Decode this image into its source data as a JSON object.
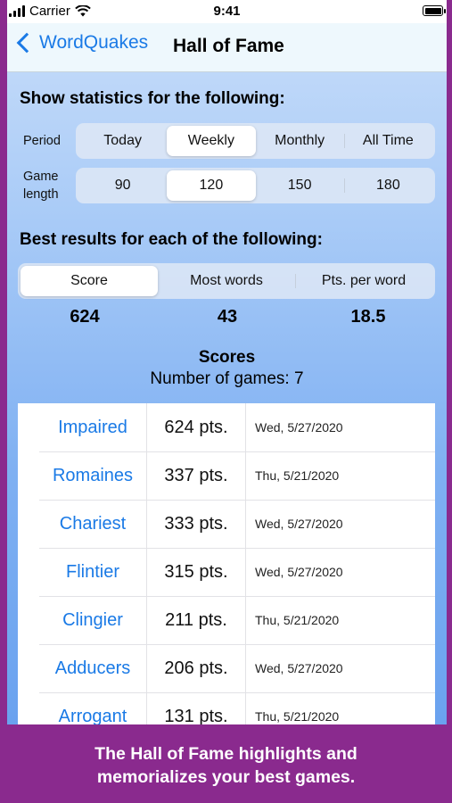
{
  "status_bar": {
    "carrier": "Carrier",
    "time": "9:41"
  },
  "nav": {
    "back_label": "WordQuakes",
    "title": "Hall of Fame"
  },
  "filters": {
    "heading": "Show statistics for the following:",
    "period": {
      "label": "Period",
      "options": [
        "Today",
        "Weekly",
        "Monthly",
        "All Time"
      ],
      "selected": "Weekly"
    },
    "game_length": {
      "label_line1": "Game",
      "label_line2": "length",
      "options": [
        "90",
        "120",
        "150",
        "180"
      ],
      "selected": "120"
    }
  },
  "best": {
    "heading": "Best results for each of the following:",
    "options": [
      "Score",
      "Most words",
      "Pts. per word"
    ],
    "selected": "Score",
    "values": [
      "624",
      "43",
      "18.5"
    ]
  },
  "scores": {
    "title": "Scores",
    "subtitle": "Number of games: 7",
    "rows": [
      {
        "word": "Impaired",
        "points": "624 pts.",
        "date": "Wed, 5/27/2020"
      },
      {
        "word": "Romaines",
        "points": "337 pts.",
        "date": "Thu, 5/21/2020"
      },
      {
        "word": "Chariest",
        "points": "333 pts.",
        "date": "Wed, 5/27/2020"
      },
      {
        "word": "Flintier",
        "points": "315 pts.",
        "date": "Wed, 5/27/2020"
      },
      {
        "word": "Clingier",
        "points": "211 pts.",
        "date": "Thu, 5/21/2020"
      },
      {
        "word": "Adducers",
        "points": "206 pts.",
        "date": "Wed, 5/27/2020"
      },
      {
        "word": "Arrogant",
        "points": "131 pts.",
        "date": "Thu, 5/21/2020"
      }
    ]
  },
  "caption": {
    "line1": "The Hall of Fame highlights and",
    "line2": "memorializes your best games."
  },
  "colors": {
    "accent": "#1a7ae6",
    "frame": "#8a2a8e"
  }
}
